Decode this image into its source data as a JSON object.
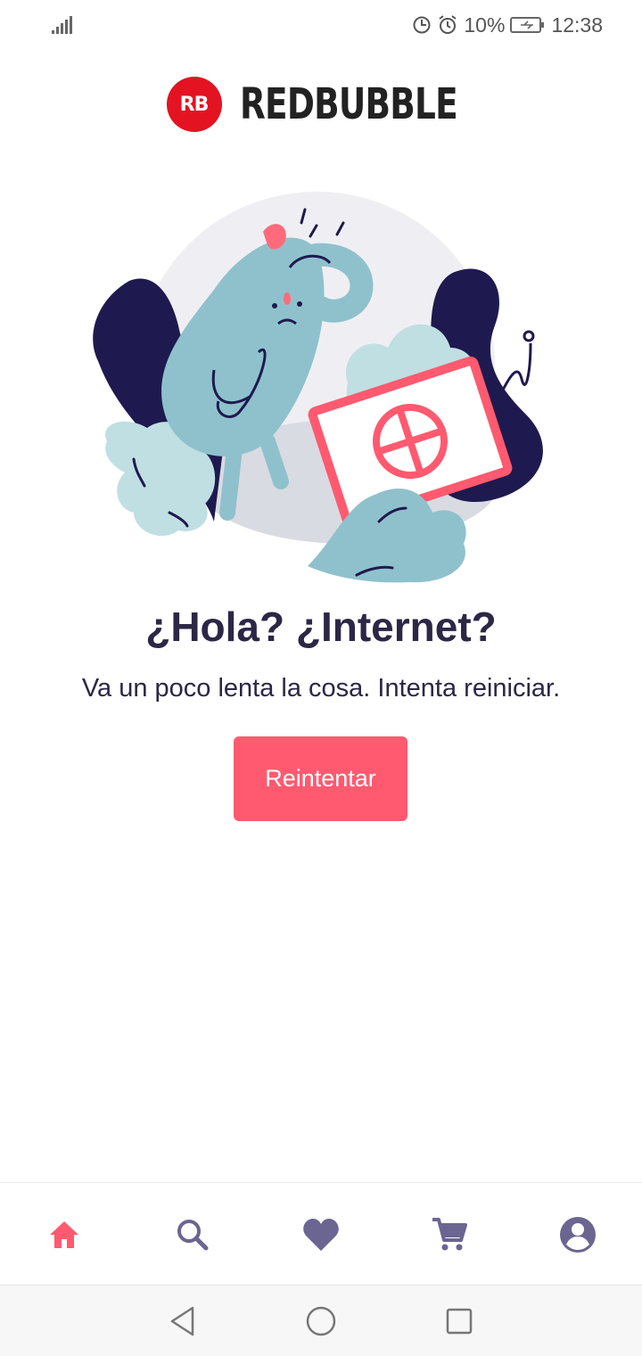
{
  "status_bar": {
    "battery": "10%",
    "time": "12:38"
  },
  "brand": {
    "mark": "RB",
    "name": "REDBUBBLE"
  },
  "error": {
    "title": "¿Hola? ¿Internet?",
    "message": "Va un poco lenta la cosa. Intenta reiniciar.",
    "retry_label": "Reintentar"
  },
  "bottom_nav": {
    "items": [
      {
        "icon": "home-icon",
        "active": true
      },
      {
        "icon": "search-icon",
        "active": false
      },
      {
        "icon": "heart-icon",
        "active": false
      },
      {
        "icon": "cart-icon",
        "active": false
      },
      {
        "icon": "account-icon",
        "active": false
      }
    ]
  },
  "colors": {
    "accent": "#ff5a6f",
    "brand_red": "#e41321",
    "text_dark": "#2b2745",
    "nav_inactive": "#6b6591"
  }
}
